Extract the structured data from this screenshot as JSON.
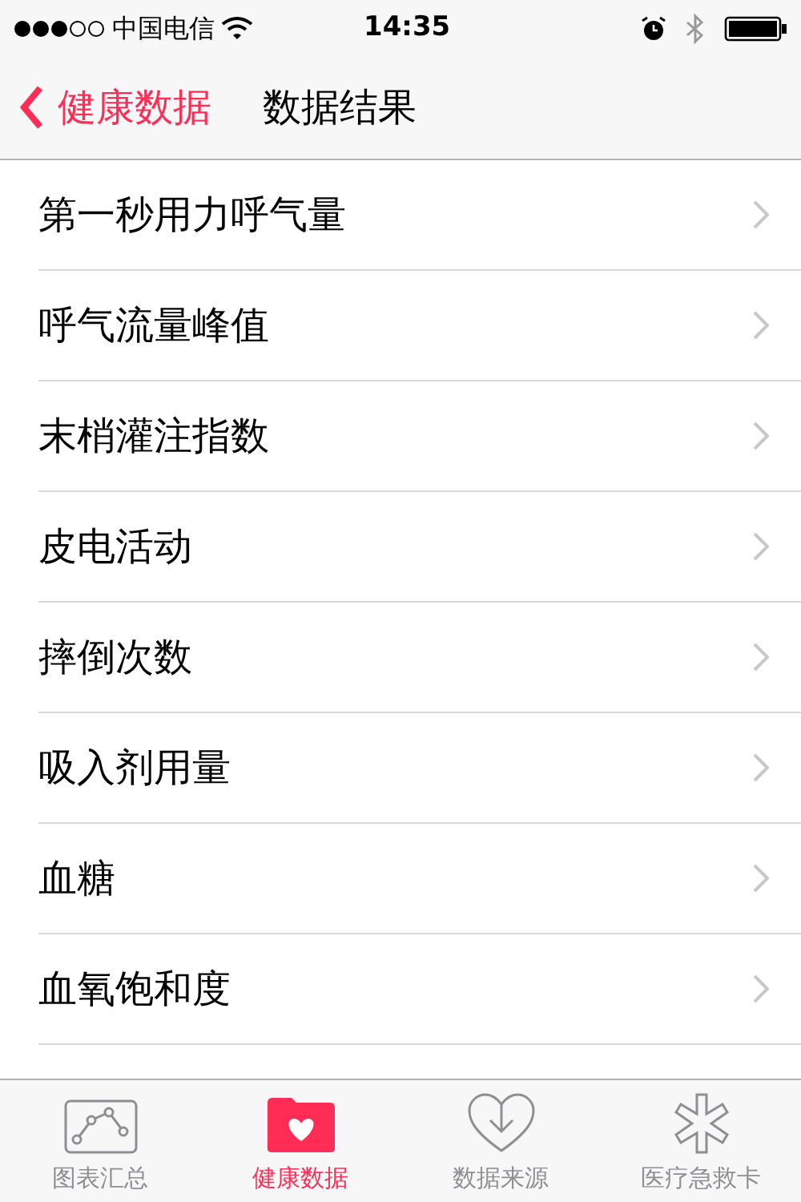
{
  "status_bar": {
    "carrier": "中国电信",
    "time": "14:35"
  },
  "nav_bar": {
    "back_label": "健康数据",
    "title": "数据结果"
  },
  "rows": [
    {
      "label": "第一秒用力呼气量"
    },
    {
      "label": "呼气流量峰值"
    },
    {
      "label": "末梢灌注指数"
    },
    {
      "label": "皮电活动"
    },
    {
      "label": "摔倒次数"
    },
    {
      "label": "吸入剂用量"
    },
    {
      "label": "血糖"
    },
    {
      "label": "血氧饱和度"
    }
  ],
  "tab_bar": [
    {
      "kind": "chart",
      "label": "图表汇总",
      "selected": false
    },
    {
      "kind": "folder",
      "label": "健康数据",
      "selected": true
    },
    {
      "kind": "source",
      "label": "数据来源",
      "selected": false
    },
    {
      "kind": "medical",
      "label": "医疗急救卡",
      "selected": false
    }
  ]
}
